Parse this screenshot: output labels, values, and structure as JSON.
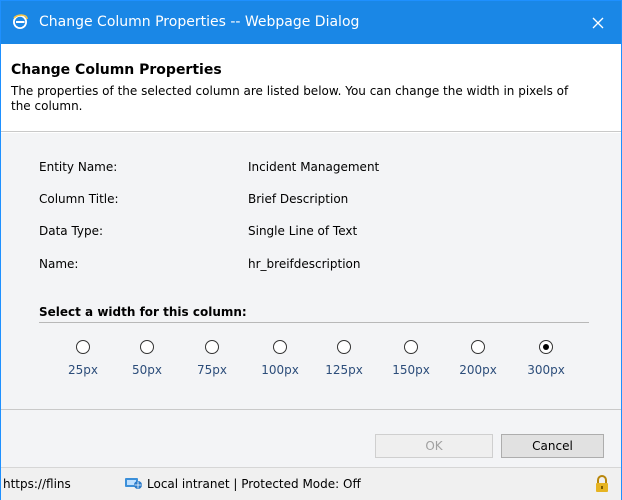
{
  "window": {
    "title": "Change Column Properties -- Webpage Dialog",
    "icons": {
      "app": "ie-icon",
      "close": "close-icon"
    }
  },
  "header": {
    "title": "Change Column Properties",
    "description": "The properties of the selected column are listed below. You can change the width in pixels of the column."
  },
  "properties": [
    {
      "label": "Entity Name:",
      "value": "Incident Management"
    },
    {
      "label": "Column Title:",
      "value": "Brief Description"
    },
    {
      "label": "Data Type:",
      "value": "Single Line of Text"
    },
    {
      "label": "Name:",
      "value": "hr_breifdescription"
    }
  ],
  "width_section": {
    "title": "Select a width for this column:",
    "options": [
      "25px",
      "50px",
      "75px",
      "100px",
      "125px",
      "150px",
      "200px",
      "300px"
    ],
    "selected": "300px"
  },
  "buttons": {
    "ok_label": "OK",
    "cancel_label": "Cancel"
  },
  "statusbar": {
    "url": "https://flins",
    "zone": "Local intranet | Protected Mode: Off",
    "icons": {
      "zone": "intranet-icon",
      "lock": "lock-icon"
    }
  },
  "colors": {
    "titlebar": "#1a87e6",
    "body_bg": "#f3f4f6",
    "radio_label": "#2c4d7a"
  }
}
